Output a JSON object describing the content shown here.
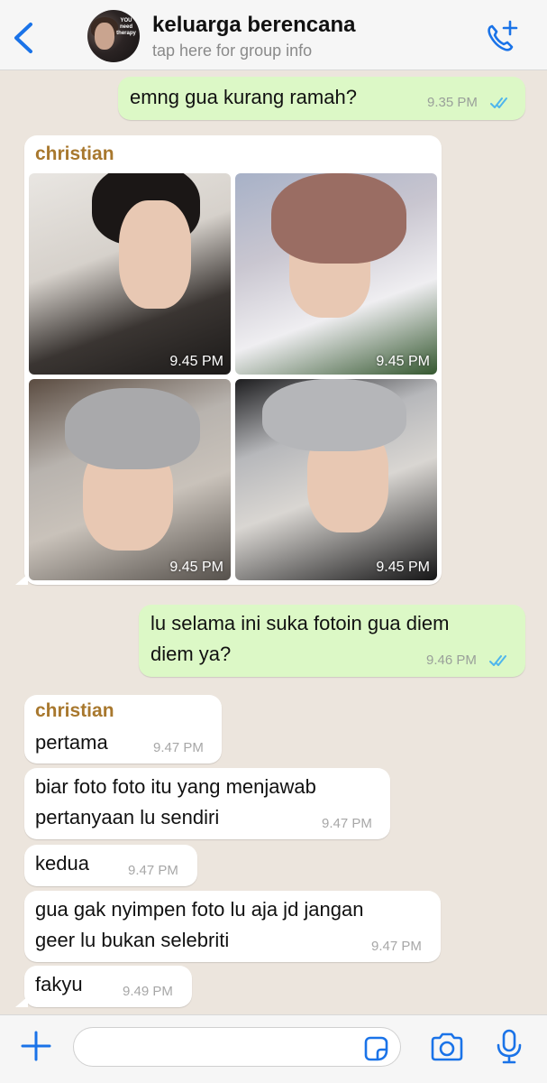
{
  "header": {
    "title": "keluarga berencana",
    "subtitle": "tap here for group info",
    "avatar_text": "YOU need therapy"
  },
  "messages": [
    {
      "type": "outgoing",
      "text": "emng gua kurang ramah?",
      "time": "9.35 PM"
    },
    {
      "type": "incoming",
      "sender": "christian",
      "photos": [
        {
          "time": "9.45 PM"
        },
        {
          "time": "9.45 PM"
        },
        {
          "time": "9.45 PM"
        },
        {
          "time": "9.45 PM"
        }
      ]
    },
    {
      "type": "outgoing",
      "lines": [
        "lu selama ini suka fotoin gua diem",
        "diem ya?"
      ],
      "time": "9.46 PM"
    },
    {
      "type": "incoming",
      "sender": "christian",
      "text": "pertama",
      "time": "9.47 PM"
    },
    {
      "type": "incoming",
      "lines": [
        "biar foto foto itu yang menjawab",
        "pertanyaan lu sendiri"
      ],
      "time": "9.47 PM"
    },
    {
      "type": "incoming",
      "text": "kedua",
      "time": "9.47 PM"
    },
    {
      "type": "incoming",
      "lines": [
        "gua gak nyimpen foto lu aja jd jangan",
        "geer lu bukan selebriti"
      ],
      "time": "9.47 PM"
    },
    {
      "type": "incoming",
      "text": "fakyu",
      "time": "9.49 PM"
    }
  ],
  "composer": {
    "input_value": "",
    "icons": [
      "plus-icon",
      "sticker-icon",
      "camera-icon",
      "microphone-icon"
    ]
  },
  "colors": {
    "outgoing_bubble": "#dcf8c6",
    "incoming_bubble": "#ffffff",
    "accent": "#1a73e8",
    "sender_name": "#a8782e",
    "read_ticks": "#4fb6ec"
  }
}
